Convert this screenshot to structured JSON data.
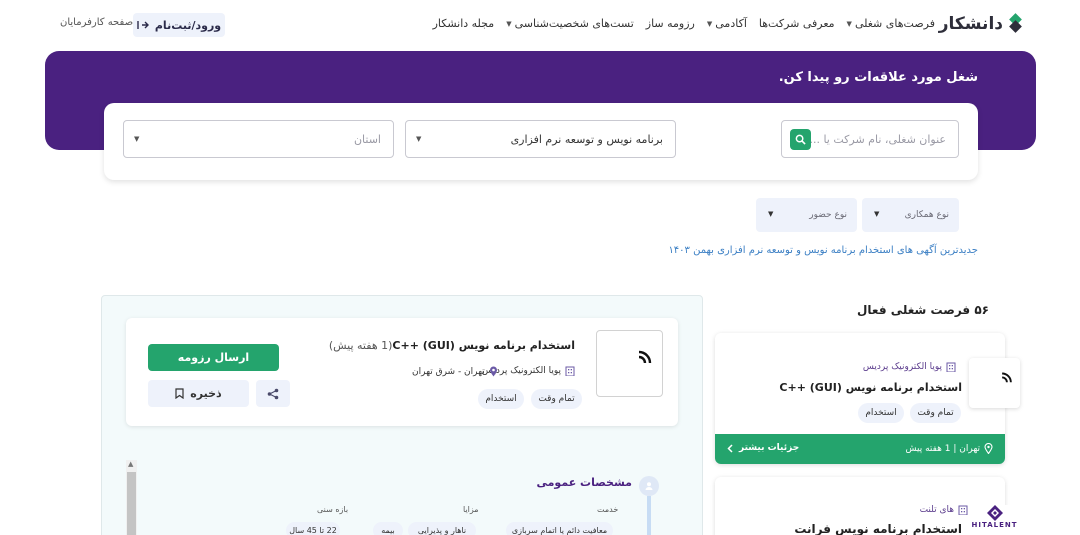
{
  "nav": {
    "logo_text": "دانشکار",
    "menu": [
      {
        "label": "فرصت‌های شغلی",
        "caret": true
      },
      {
        "label": "معرفی شرکت‌ها",
        "caret": false
      },
      {
        "label": "آکادمی",
        "caret": true
      },
      {
        "label": "رزومه ساز",
        "caret": false
      },
      {
        "label": "تست‌های شخصیت‌شناسی",
        "caret": true
      },
      {
        "label": "مجله دانشکار",
        "caret": false
      }
    ],
    "login_label": "ورود/ثبت‌نام",
    "employer_link": "صفحه کارفرمایان"
  },
  "hero": {
    "title": "شغل مورد علاقه‌ات رو پیدا کن.",
    "search_placeholder": "عنوان شغلی، نام شرکت یا ...",
    "category_value": "برنامه نویس و توسعه نرم افزاری",
    "province_placeholder": "استان"
  },
  "filters": {
    "cooperation_type": "نوع همکاری",
    "presence_type": "نوع حضور"
  },
  "latest_link": "جدیدترین آگهی های استخدام برنامه نویس و توسعه نرم افزاری بهمن ۱۴۰۳",
  "detail": {
    "title": "استخدام برنامه نویس (GUI) ++C",
    "ago": "(1 هفته پیش)",
    "company": "پویا الکترونیک پردیس",
    "location": "تهران - شرق تهران",
    "tags": [
      "تمام وقت",
      "استخدام"
    ],
    "apply_label": "ارسال رزومه",
    "save_label": "ذخیره",
    "spec_title": "مشخصات عمومی",
    "spec_labels": {
      "service": "خدمت",
      "benefits": "مزایا",
      "age": "بازه سنی"
    },
    "service_value": "معافیت دائم یا اتمام سربازی",
    "benefits": [
      "ناهار و پذیرایی",
      "بیمه"
    ],
    "age_value": "22 تا 45 سال"
  },
  "list": {
    "count_title": "۵۶ فرصت شغلی فعال",
    "cards": [
      {
        "company": "پویا الکترونیک پردیس",
        "title": "استخدام برنامه نویس (GUI) ++C",
        "tags": [
          "تمام وقت",
          "استخدام"
        ],
        "location": "تهران | 1 هفته پیش",
        "more_label": "جزئیات بیشتر"
      },
      {
        "company": "های تلنت",
        "title": "استخدام برنامه نویس فرانت",
        "logo_text": "HITALENT"
      }
    ]
  },
  "colors": {
    "primary_purple": "#4a2180",
    "accent_green": "#24a46d",
    "soft_bg": "#eef2fb"
  }
}
